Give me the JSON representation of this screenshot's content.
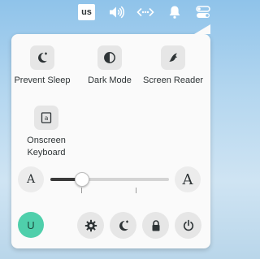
{
  "topbar": {
    "keyboard_layout": "us",
    "icons": [
      "volume-icon",
      "network-icon",
      "notifications-bell-icon",
      "system-menu-toggle-icon"
    ]
  },
  "quick_settings": [
    {
      "label": "Prevent Sleep",
      "icon": "moon-plus-icon"
    },
    {
      "label": "Dark Mode",
      "icon": "contrast-icon"
    },
    {
      "label": "Screen Reader",
      "icon": "screen-reader-icon"
    },
    {
      "label": "Onscreen\nKeyboard",
      "icon": "onscreen-keyboard-icon"
    }
  ],
  "font_size": {
    "small_label": "A",
    "large_label": "A",
    "value_fraction": 0.27
  },
  "user": {
    "initial": "U",
    "avatar_color": "#4fcfab"
  },
  "actions": [
    {
      "name": "settings",
      "icon": "gear-icon"
    },
    {
      "name": "suspend",
      "icon": "moon-icon"
    },
    {
      "name": "lock",
      "icon": "lock-icon"
    },
    {
      "name": "power",
      "icon": "power-icon"
    }
  ]
}
